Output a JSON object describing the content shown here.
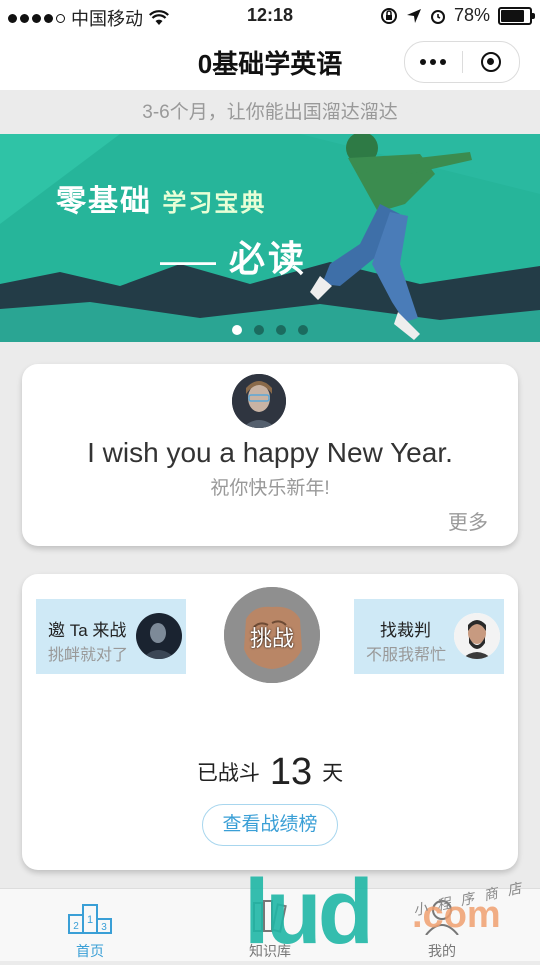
{
  "status_bar": {
    "carrier": "中国移动",
    "time": "12:18",
    "battery_percent": "78%",
    "battery_level": 0.78,
    "signal_bars": 4
  },
  "nav": {
    "title": "0基础学英语"
  },
  "subtitle": "3-6个月，让你能出国溜达溜达",
  "banner": {
    "title_line1_big": "零基础",
    "title_line1_small": "学习宝典",
    "title_line2_dash": "——",
    "title_line2": "必读",
    "slide_count": 4,
    "active_slide": 1,
    "colors": {
      "teal": "#26b59a",
      "dark": "#233c47"
    }
  },
  "daily_sentence": {
    "english": "I wish you a happy New Year.",
    "chinese": "祝你快乐新年!",
    "more_label": "更多"
  },
  "battle": {
    "invite_title": "邀 Ta 来战",
    "invite_sub": "挑衅就对了",
    "challenge_label": "挑战",
    "referee_title": "找裁判",
    "referee_sub": "不服我帮忙",
    "days_prefix": "已战斗",
    "days_count": "13",
    "days_suffix": "天",
    "rank_button": "查看战绩榜"
  },
  "tabbar": {
    "tabs": [
      {
        "label": "首页",
        "active": true
      },
      {
        "label": "知识库",
        "active": false
      },
      {
        "label": "我的",
        "active": false
      }
    ]
  },
  "watermark": {
    "main": "lud",
    "suffix": ".com",
    "script_text": "小程序商店"
  },
  "colors": {
    "accent_blue": "#3a9fd6",
    "light_blue_box": "#cfe9f6"
  }
}
